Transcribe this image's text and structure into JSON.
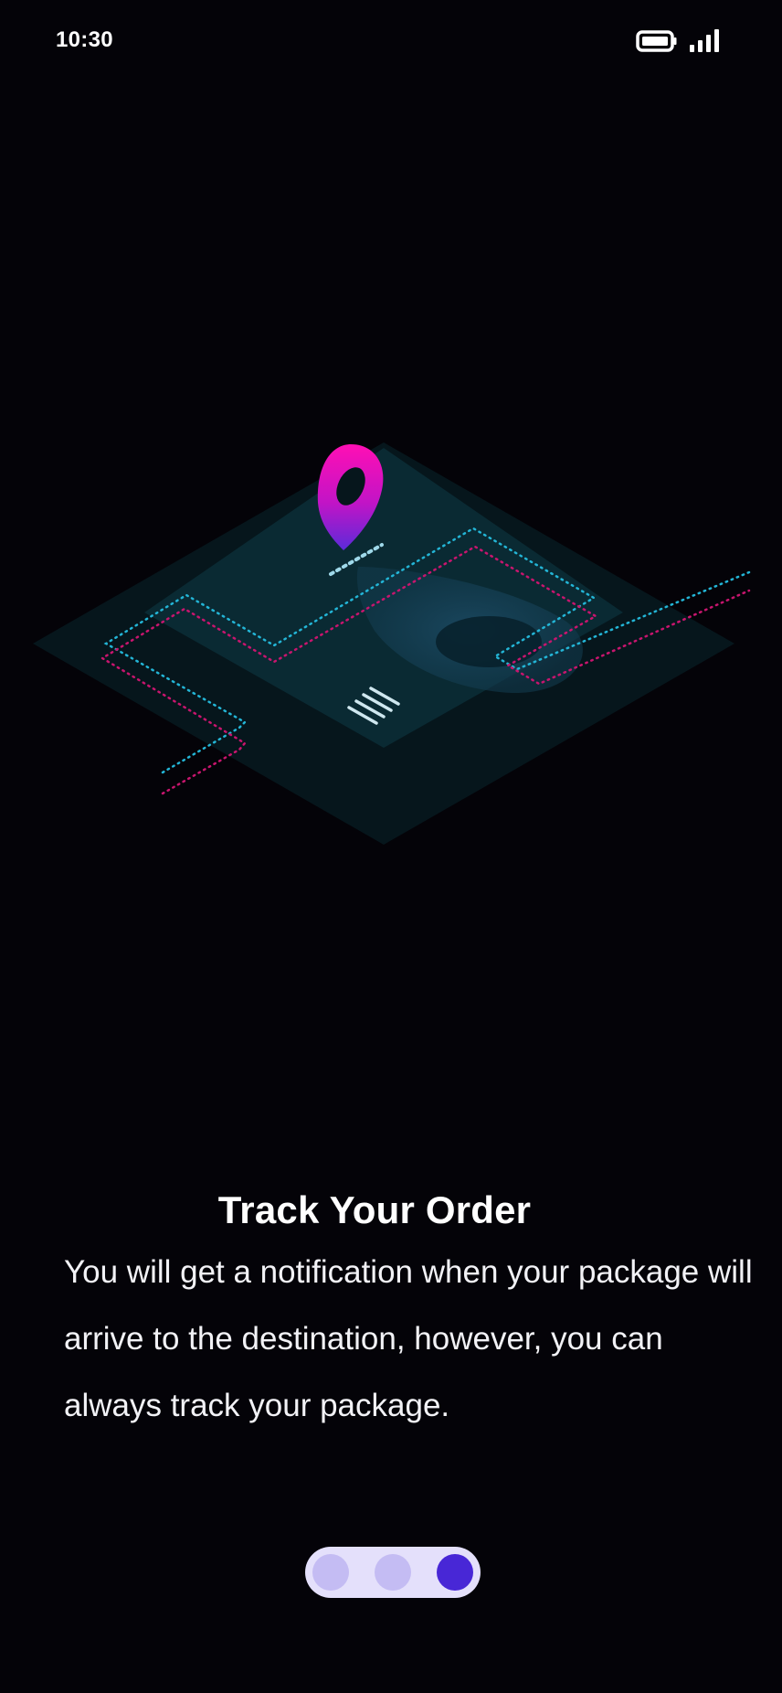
{
  "status_bar": {
    "time": "10:30",
    "icons": [
      "battery-icon",
      "signal-icon"
    ]
  },
  "illustration": {
    "icon": "map-location-pin-icon",
    "colors": {
      "pin_top": "#ff0fb4",
      "pin_bottom": "#5b2bd9",
      "platform_dark": "#06161c",
      "platform_light": "#0a2a33",
      "route_cyan": "#23b5d6",
      "route_pink": "#c8156e"
    }
  },
  "onboarding": {
    "title": "Track Your Order",
    "description": "You will get a notification when your package will arrive to the destination, however, you can always track your package."
  },
  "pager": {
    "pages": 3,
    "active_index": 2,
    "colors": {
      "track": "#e4e0fb",
      "inactive": "#c4bcf3",
      "active": "#4827d6"
    }
  },
  "background": "#040308"
}
